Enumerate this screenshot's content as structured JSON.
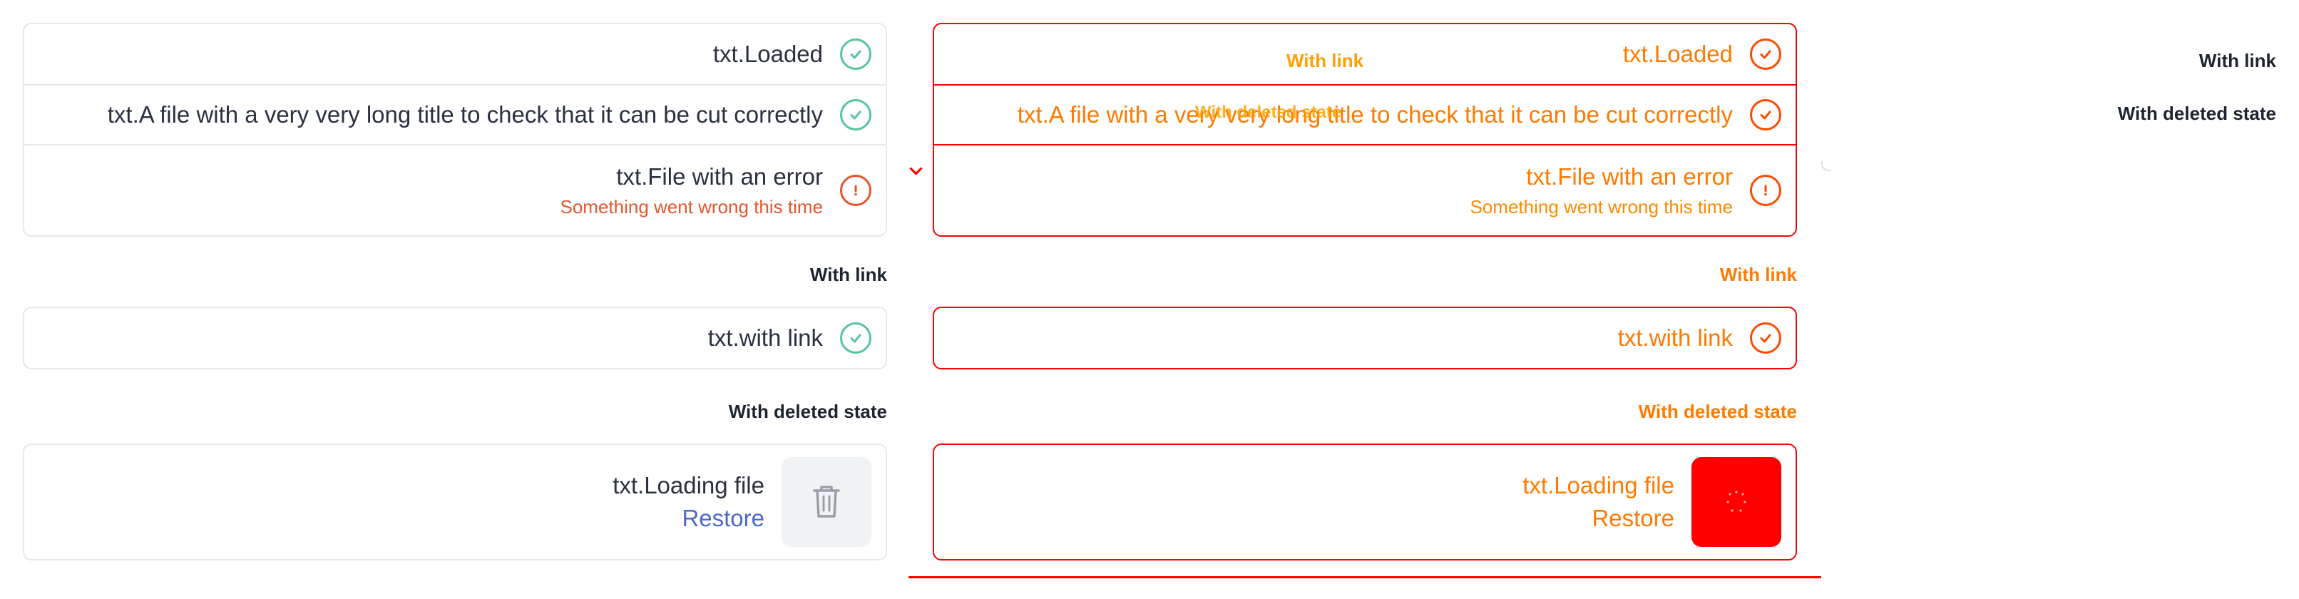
{
  "files_card": {
    "rows": [
      {
        "title": "txt.Loaded",
        "status": "success",
        "icon": "check-circle-icon"
      },
      {
        "title": "txt.A file with a very very long title to check that it can be cut correctly",
        "status": "success",
        "icon": "check-circle-icon"
      },
      {
        "title": "txt.File with an error",
        "error": "Something went wrong this time",
        "status": "error",
        "icon": "exclamation-circle-icon"
      }
    ]
  },
  "link_section": {
    "label": "With link",
    "row": {
      "title": "txt.with link",
      "status": "success",
      "icon": "check-circle-icon"
    }
  },
  "deleted_section": {
    "label": "With deleted state",
    "row": {
      "title": "txt.Loading file",
      "restore_label": "Restore",
      "icon": "trash-icon"
    }
  },
  "debug_overlay": {
    "with_link": "With link",
    "with_deleted_state": "With deleted state"
  },
  "side_labels": {
    "with_link": "With link",
    "with_deleted_state": "With deleted state"
  },
  "colors": {
    "success": "#57c4a1",
    "error": "#e4572e",
    "link": "#4d69c7",
    "border": "#e6e8ec",
    "debug_red": "#ff0000",
    "debug_orange": "#ff7a00"
  }
}
